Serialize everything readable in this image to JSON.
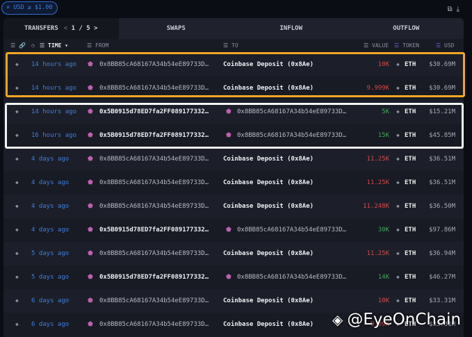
{
  "filter": {
    "label": "× USD ≥ $1.00"
  },
  "tabs": [
    {
      "label": "TRANSFERS"
    },
    {
      "label": "SWAPS"
    },
    {
      "label": "INFLOW"
    },
    {
      "label": "OUTFLOW"
    }
  ],
  "pager": {
    "prev": "<",
    "text": "1 / 5",
    "next": ">"
  },
  "columns": {
    "time": "TIME ▾",
    "from": "FROM",
    "to": "TO",
    "value": "VALUE",
    "token": "TOKEN",
    "usd": "USD"
  },
  "rows": [
    {
      "time": "14 hours ago",
      "from": "0x8BB85cA68167A34b54eE89733D…",
      "from_bold": false,
      "to": "Coinbase Deposit (0x8Ae)",
      "to_entity": true,
      "value": "10K",
      "dir": "out",
      "token": "ETH",
      "usd": "$30.69M"
    },
    {
      "time": "14 hours ago",
      "from": "0x8BB85cA68167A34b54eE89733D…",
      "from_bold": false,
      "to": "Coinbase Deposit (0x8Ae)",
      "to_entity": true,
      "value": "9.999K",
      "dir": "out",
      "token": "ETH",
      "usd": "$30.69M"
    },
    {
      "time": "14 hours ago",
      "from": "0x5B0915d78ED7fa2FF089177332…",
      "from_bold": true,
      "to": "0x8BB85cA68167A34b54eE89733D…",
      "to_entity": false,
      "value": "5K",
      "dir": "in",
      "token": "ETH",
      "usd": "$15.21M"
    },
    {
      "time": "16 hours ago",
      "from": "0x5B0915d78ED7fa2FF089177332…",
      "from_bold": true,
      "to": "0x8BB85cA68167A34b54eE89733D…",
      "to_entity": false,
      "value": "15K",
      "dir": "in",
      "token": "ETH",
      "usd": "$45.85M"
    },
    {
      "time": "4 days ago",
      "from": "0x8BB85cA68167A34b54eE89733D…",
      "from_bold": false,
      "to": "Coinbase Deposit (0x8Ae)",
      "to_entity": true,
      "value": "11.25K",
      "dir": "out",
      "token": "ETH",
      "usd": "$36.51M"
    },
    {
      "time": "4 days ago",
      "from": "0x8BB85cA68167A34b54eE89733D…",
      "from_bold": false,
      "to": "Coinbase Deposit (0x8Ae)",
      "to_entity": true,
      "value": "11.25K",
      "dir": "out",
      "token": "ETH",
      "usd": "$36.51M"
    },
    {
      "time": "4 days ago",
      "from": "0x8BB85cA68167A34b54eE89733D…",
      "from_bold": false,
      "to": "Coinbase Deposit (0x8Ae)",
      "to_entity": true,
      "value": "11.248K",
      "dir": "out",
      "token": "ETH",
      "usd": "$36.50M"
    },
    {
      "time": "4 days ago",
      "from": "0x5B0915d78ED7fa2FF089177332…",
      "from_bold": true,
      "to": "0x8BB85cA68167A34b54eE89733D…",
      "to_entity": false,
      "value": "30K",
      "dir": "in",
      "token": "ETH",
      "usd": "$97.86M"
    },
    {
      "time": "5 days ago",
      "from": "0x8BB85cA68167A34b54eE89733D…",
      "from_bold": false,
      "to": "Coinbase Deposit (0x8Ae)",
      "to_entity": true,
      "value": "11.25K",
      "dir": "out",
      "token": "ETH",
      "usd": "$36.94M"
    },
    {
      "time": "5 days ago",
      "from": "0x5B0915d78ED7fa2FF089177332…",
      "from_bold": true,
      "to": "0x8BB85cA68167A34b54eE89733D…",
      "to_entity": false,
      "value": "14K",
      "dir": "in",
      "token": "ETH",
      "usd": "$46.27M"
    },
    {
      "time": "6 days ago",
      "from": "0x8BB85cA68167A34b54eE89733D…",
      "from_bold": false,
      "to": "Coinbase Deposit (0x8Ae)",
      "to_entity": true,
      "value": "10K",
      "dir": "out",
      "token": "ETH",
      "usd": "$33.31M"
    },
    {
      "time": "6 days ago",
      "from": "0x8BB85cA68167A34b54eE89733D…",
      "from_bold": false,
      "to": "Coinbase Deposit (0x8Ae)",
      "to_entity": true,
      "value": "9.99K",
      "dir": "out",
      "token": "ETH",
      "usd": "$33.31M"
    }
  ],
  "watermark": "@EyeOnChain"
}
